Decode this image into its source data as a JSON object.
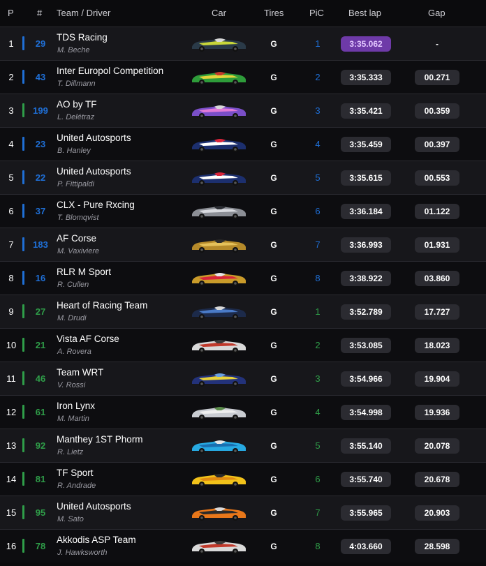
{
  "header": {
    "p": "P",
    "num": "#",
    "team": "Team / Driver",
    "car": "Car",
    "tires": "Tires",
    "pic": "PiC",
    "best_lap": "Best lap",
    "gap": "Gap"
  },
  "colors": {
    "hypercar": "#1f6fd6",
    "lmgt3": "#2f9e49",
    "lmp2": "#2f9e49",
    "best_lap": "#6e3aa8"
  },
  "rows": [
    {
      "pos": "1",
      "num": "29",
      "team": "TDS Racing",
      "driver": "M. Beche",
      "tires": "G",
      "pic": "1",
      "best_lap": "3:35.062",
      "gap": "-",
      "bar": "#1f6fd6",
      "num_color": "#1f6fd6",
      "pic_color": "#1f6fd6",
      "car_colors": [
        "#2a3a48",
        "#c7d63a",
        "#d9d9d9"
      ]
    },
    {
      "pos": "2",
      "num": "43",
      "team": "Inter Europol Competition",
      "driver": "T. Dillmann",
      "tires": "G",
      "pic": "2",
      "best_lap": "3:35.333",
      "gap": "00.271",
      "bar": "#1f6fd6",
      "num_color": "#1f6fd6",
      "pic_color": "#1f6fd6",
      "car_colors": [
        "#2e9c3a",
        "#e3d43a",
        "#c0392b"
      ]
    },
    {
      "pos": "3",
      "num": "199",
      "team": "AO by TF",
      "driver": "L. Delétraz",
      "tires": "G",
      "pic": "3",
      "best_lap": "3:35.421",
      "gap": "00.359",
      "bar": "#2f9e49",
      "num_color": "#1f6fd6",
      "pic_color": "#1f6fd6",
      "car_colors": [
        "#7a4fc8",
        "#e27bd8",
        "#d8d8d8"
      ]
    },
    {
      "pos": "4",
      "num": "23",
      "team": "United Autosports",
      "driver": "B. Hanley",
      "tires": "G",
      "pic": "4",
      "best_lap": "3:35.459",
      "gap": "00.397",
      "bar": "#1f6fd6",
      "num_color": "#1f6fd6",
      "pic_color": "#1f6fd6",
      "car_colors": [
        "#1c2f6e",
        "#ffffff",
        "#d8253a"
      ]
    },
    {
      "pos": "5",
      "num": "22",
      "team": "United Autosports",
      "driver": "P. Fittipaldi",
      "tires": "G",
      "pic": "5",
      "best_lap": "3:35.615",
      "gap": "00.553",
      "bar": "#1f6fd6",
      "num_color": "#1f6fd6",
      "pic_color": "#1f6fd6",
      "car_colors": [
        "#1c2f6e",
        "#ffffff",
        "#d8253a"
      ]
    },
    {
      "pos": "6",
      "num": "37",
      "team": "CLX - Pure Rxcing",
      "driver": "T. Blomqvist",
      "tires": "G",
      "pic": "6",
      "best_lap": "3:36.184",
      "gap": "01.122",
      "bar": "#1f6fd6",
      "num_color": "#1f6fd6",
      "pic_color": "#1f6fd6",
      "car_colors": [
        "#8c8f96",
        "#d9dbe0",
        "#2b2d33"
      ]
    },
    {
      "pos": "7",
      "num": "183",
      "team": "AF Corse",
      "driver": "M. Vaxiviere",
      "tires": "G",
      "pic": "7",
      "best_lap": "3:36.993",
      "gap": "01.931",
      "bar": "#1f6fd6",
      "num_color": "#1f6fd6",
      "pic_color": "#1f6fd6",
      "car_colors": [
        "#b58a2a",
        "#e5c15a",
        "#2a2a2a"
      ]
    },
    {
      "pos": "8",
      "num": "16",
      "team": "RLR M Sport",
      "driver": "R. Cullen",
      "tires": "G",
      "pic": "8",
      "best_lap": "3:38.922",
      "gap": "03.860",
      "bar": "#1f6fd6",
      "num_color": "#1f6fd6",
      "pic_color": "#1f6fd6",
      "car_colors": [
        "#c99b2a",
        "#d8253a",
        "#e6e6e6"
      ]
    },
    {
      "pos": "9",
      "num": "27",
      "team": "Heart of Racing Team",
      "driver": "M. Drudi",
      "tires": "G",
      "pic": "1",
      "best_lap": "3:52.789",
      "gap": "17.727",
      "bar": "#2f9e49",
      "num_color": "#2f9e49",
      "pic_color": "#2f9e49",
      "car_colors": [
        "#1c2a4a",
        "#4a7bc8",
        "#d9d9d9"
      ]
    },
    {
      "pos": "10",
      "num": "21",
      "team": "Vista AF Corse",
      "driver": "A. Rovera",
      "tires": "G",
      "pic": "2",
      "best_lap": "3:53.085",
      "gap": "18.023",
      "bar": "#2f9e49",
      "num_color": "#2f9e49",
      "pic_color": "#2f9e49",
      "car_colors": [
        "#d9d9d9",
        "#c0392b",
        "#3a3a3a"
      ]
    },
    {
      "pos": "11",
      "num": "46",
      "team": "Team WRT",
      "driver": "V. Rossi",
      "tires": "G",
      "pic": "3",
      "best_lap": "3:54.966",
      "gap": "19.904",
      "bar": "#2f9e49",
      "num_color": "#2f9e49",
      "pic_color": "#2f9e49",
      "car_colors": [
        "#23327a",
        "#e8d23a",
        "#6aa0e0"
      ]
    },
    {
      "pos": "12",
      "num": "61",
      "team": "Iron Lynx",
      "driver": "M. Martin",
      "tires": "G",
      "pic": "4",
      "best_lap": "3:54.998",
      "gap": "19.936",
      "bar": "#2f9e49",
      "num_color": "#2f9e49",
      "pic_color": "#2f9e49",
      "car_colors": [
        "#c9ccd2",
        "#eeeeee",
        "#5a8a4a"
      ]
    },
    {
      "pos": "13",
      "num": "92",
      "team": "Manthey 1ST Phorm",
      "driver": "R. Lietz",
      "tires": "G",
      "pic": "5",
      "best_lap": "3:55.140",
      "gap": "20.078",
      "bar": "#2f9e49",
      "num_color": "#2f9e49",
      "pic_color": "#2f9e49",
      "car_colors": [
        "#27a9e1",
        "#1a6fb0",
        "#e5e5e5"
      ]
    },
    {
      "pos": "14",
      "num": "81",
      "team": "TF Sport",
      "driver": "R. Andrade",
      "tires": "G",
      "pic": "6",
      "best_lap": "3:55.740",
      "gap": "20.678",
      "bar": "#2f9e49",
      "num_color": "#2f9e49",
      "pic_color": "#2f9e49",
      "car_colors": [
        "#f2c21a",
        "#e08a12",
        "#2a2a2a"
      ]
    },
    {
      "pos": "15",
      "num": "95",
      "team": "United Autosports",
      "driver": "M. Sato",
      "tires": "G",
      "pic": "7",
      "best_lap": "3:55.965",
      "gap": "20.903",
      "bar": "#2f9e49",
      "num_color": "#2f9e49",
      "pic_color": "#2f9e49",
      "car_colors": [
        "#e8771a",
        "#2a2a2a",
        "#d9d9d9"
      ]
    },
    {
      "pos": "16",
      "num": "78",
      "team": "Akkodis ASP Team",
      "driver": "J. Hawksworth",
      "tires": "G",
      "pic": "8",
      "best_lap": "4:03.660",
      "gap": "28.598",
      "bar": "#2f9e49",
      "num_color": "#2f9e49",
      "pic_color": "#2f9e49",
      "car_colors": [
        "#d9d9d9",
        "#c0392b",
        "#3a3a3a"
      ]
    }
  ]
}
